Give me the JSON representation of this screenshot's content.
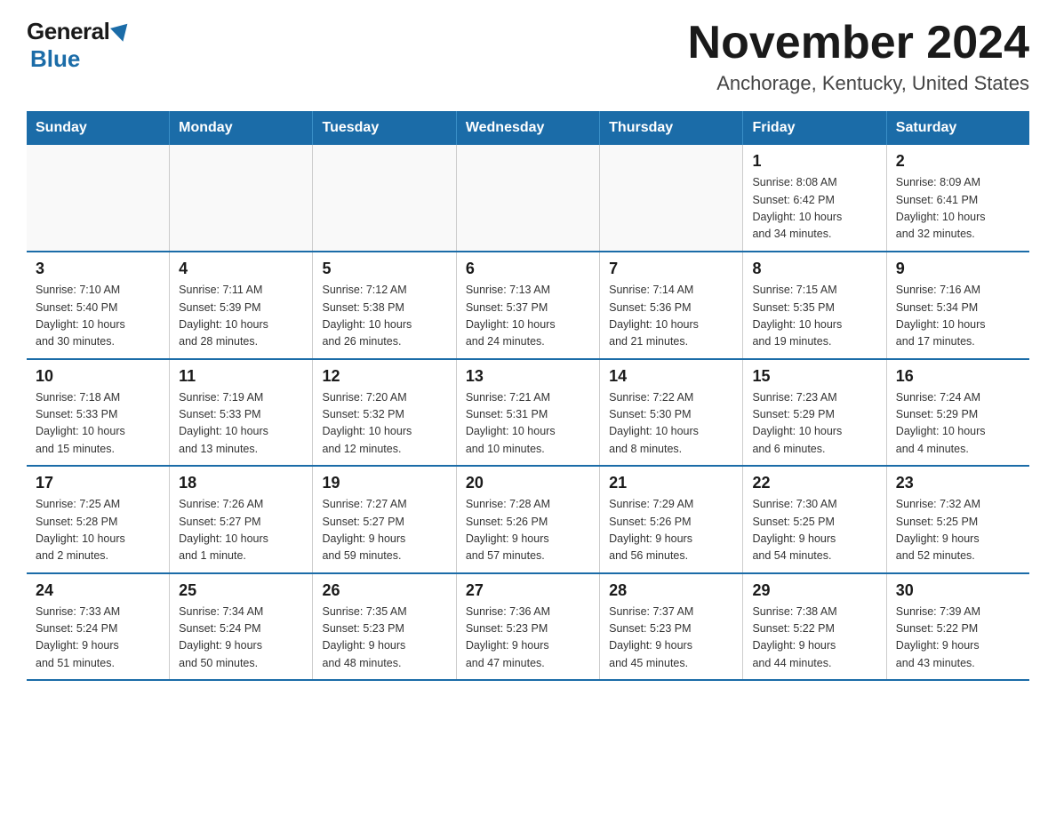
{
  "header": {
    "logo_general": "General",
    "logo_blue": "Blue",
    "title": "November 2024",
    "subtitle": "Anchorage, Kentucky, United States"
  },
  "days_of_week": [
    "Sunday",
    "Monday",
    "Tuesday",
    "Wednesday",
    "Thursday",
    "Friday",
    "Saturday"
  ],
  "weeks": [
    [
      {
        "day": "",
        "info": ""
      },
      {
        "day": "",
        "info": ""
      },
      {
        "day": "",
        "info": ""
      },
      {
        "day": "",
        "info": ""
      },
      {
        "day": "",
        "info": ""
      },
      {
        "day": "1",
        "info": "Sunrise: 8:08 AM\nSunset: 6:42 PM\nDaylight: 10 hours\nand 34 minutes."
      },
      {
        "day": "2",
        "info": "Sunrise: 8:09 AM\nSunset: 6:41 PM\nDaylight: 10 hours\nand 32 minutes."
      }
    ],
    [
      {
        "day": "3",
        "info": "Sunrise: 7:10 AM\nSunset: 5:40 PM\nDaylight: 10 hours\nand 30 minutes."
      },
      {
        "day": "4",
        "info": "Sunrise: 7:11 AM\nSunset: 5:39 PM\nDaylight: 10 hours\nand 28 minutes."
      },
      {
        "day": "5",
        "info": "Sunrise: 7:12 AM\nSunset: 5:38 PM\nDaylight: 10 hours\nand 26 minutes."
      },
      {
        "day": "6",
        "info": "Sunrise: 7:13 AM\nSunset: 5:37 PM\nDaylight: 10 hours\nand 24 minutes."
      },
      {
        "day": "7",
        "info": "Sunrise: 7:14 AM\nSunset: 5:36 PM\nDaylight: 10 hours\nand 21 minutes."
      },
      {
        "day": "8",
        "info": "Sunrise: 7:15 AM\nSunset: 5:35 PM\nDaylight: 10 hours\nand 19 minutes."
      },
      {
        "day": "9",
        "info": "Sunrise: 7:16 AM\nSunset: 5:34 PM\nDaylight: 10 hours\nand 17 minutes."
      }
    ],
    [
      {
        "day": "10",
        "info": "Sunrise: 7:18 AM\nSunset: 5:33 PM\nDaylight: 10 hours\nand 15 minutes."
      },
      {
        "day": "11",
        "info": "Sunrise: 7:19 AM\nSunset: 5:33 PM\nDaylight: 10 hours\nand 13 minutes."
      },
      {
        "day": "12",
        "info": "Sunrise: 7:20 AM\nSunset: 5:32 PM\nDaylight: 10 hours\nand 12 minutes."
      },
      {
        "day": "13",
        "info": "Sunrise: 7:21 AM\nSunset: 5:31 PM\nDaylight: 10 hours\nand 10 minutes."
      },
      {
        "day": "14",
        "info": "Sunrise: 7:22 AM\nSunset: 5:30 PM\nDaylight: 10 hours\nand 8 minutes."
      },
      {
        "day": "15",
        "info": "Sunrise: 7:23 AM\nSunset: 5:29 PM\nDaylight: 10 hours\nand 6 minutes."
      },
      {
        "day": "16",
        "info": "Sunrise: 7:24 AM\nSunset: 5:29 PM\nDaylight: 10 hours\nand 4 minutes."
      }
    ],
    [
      {
        "day": "17",
        "info": "Sunrise: 7:25 AM\nSunset: 5:28 PM\nDaylight: 10 hours\nand 2 minutes."
      },
      {
        "day": "18",
        "info": "Sunrise: 7:26 AM\nSunset: 5:27 PM\nDaylight: 10 hours\nand 1 minute."
      },
      {
        "day": "19",
        "info": "Sunrise: 7:27 AM\nSunset: 5:27 PM\nDaylight: 9 hours\nand 59 minutes."
      },
      {
        "day": "20",
        "info": "Sunrise: 7:28 AM\nSunset: 5:26 PM\nDaylight: 9 hours\nand 57 minutes."
      },
      {
        "day": "21",
        "info": "Sunrise: 7:29 AM\nSunset: 5:26 PM\nDaylight: 9 hours\nand 56 minutes."
      },
      {
        "day": "22",
        "info": "Sunrise: 7:30 AM\nSunset: 5:25 PM\nDaylight: 9 hours\nand 54 minutes."
      },
      {
        "day": "23",
        "info": "Sunrise: 7:32 AM\nSunset: 5:25 PM\nDaylight: 9 hours\nand 52 minutes."
      }
    ],
    [
      {
        "day": "24",
        "info": "Sunrise: 7:33 AM\nSunset: 5:24 PM\nDaylight: 9 hours\nand 51 minutes."
      },
      {
        "day": "25",
        "info": "Sunrise: 7:34 AM\nSunset: 5:24 PM\nDaylight: 9 hours\nand 50 minutes."
      },
      {
        "day": "26",
        "info": "Sunrise: 7:35 AM\nSunset: 5:23 PM\nDaylight: 9 hours\nand 48 minutes."
      },
      {
        "day": "27",
        "info": "Sunrise: 7:36 AM\nSunset: 5:23 PM\nDaylight: 9 hours\nand 47 minutes."
      },
      {
        "day": "28",
        "info": "Sunrise: 7:37 AM\nSunset: 5:23 PM\nDaylight: 9 hours\nand 45 minutes."
      },
      {
        "day": "29",
        "info": "Sunrise: 7:38 AM\nSunset: 5:22 PM\nDaylight: 9 hours\nand 44 minutes."
      },
      {
        "day": "30",
        "info": "Sunrise: 7:39 AM\nSunset: 5:22 PM\nDaylight: 9 hours\nand 43 minutes."
      }
    ]
  ]
}
